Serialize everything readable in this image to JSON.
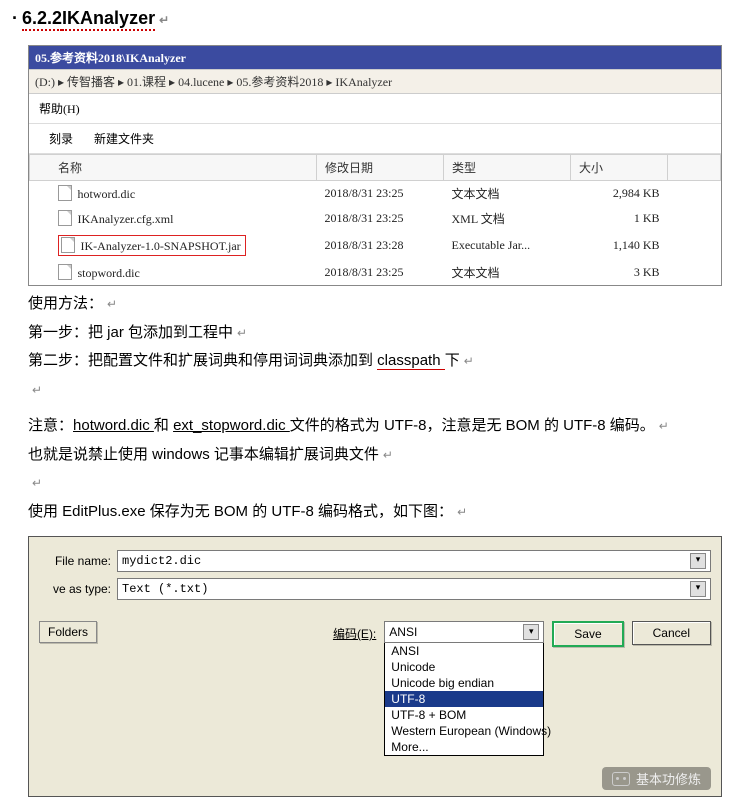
{
  "heading": {
    "bullet": "·",
    "num": "6.2.2",
    "title": "IKAnalyzer"
  },
  "explorer": {
    "title": "05.参考资料2018\\IKAnalyzer",
    "address": "(D:) ▸ 传智播客 ▸ 01.课程 ▸ 04.lucene ▸ 05.参考资料2018 ▸ IKAnalyzer",
    "menu": "帮助(H)",
    "toolbar": {
      "a": "刻录",
      "b": "新建文件夹"
    },
    "cols": {
      "name": "名称",
      "date": "修改日期",
      "type": "类型",
      "size": "大小"
    },
    "rows": [
      {
        "name": "hotword.dic",
        "date": "2018/8/31 23:25",
        "type": "文本文档",
        "size": "2,984 KB",
        "hl": false
      },
      {
        "name": "IKAnalyzer.cfg.xml",
        "date": "2018/8/31 23:25",
        "type": "XML 文档",
        "size": "1 KB",
        "hl": false
      },
      {
        "name": "IK-Analyzer-1.0-SNAPSHOT.jar",
        "date": "2018/8/31 23:28",
        "type": "Executable Jar...",
        "size": "1,140 KB",
        "hl": true
      },
      {
        "name": "stopword.dic",
        "date": "2018/8/31 23:25",
        "type": "文本文档",
        "size": "3 KB",
        "hl": false
      }
    ]
  },
  "text": {
    "p1": "使用方法：",
    "p2": "第一步：把 jar 包添加到工程中",
    "p3a": "第二步：把配置文件和扩展词典和停用词词典添加到 ",
    "p3b": "classpath ",
    "p3c": "下",
    "p4a": "注意：",
    "p4b": "hotword.dic ",
    "p4c": "和 ",
    "p4d": "ext_stopword.dic ",
    "p4e": "文件的格式为 UTF-8，注意是无 BOM 的 UTF-8 编码。",
    "p5": "也就是说禁止使用 windows 记事本编辑扩展词典文件",
    "p6": "使用 EditPlus.exe 保存为无 BOM 的 UTF-8 编码格式，如下图："
  },
  "saveas": {
    "filename_label": "File name:",
    "filename_value": "mydict2.dic",
    "type_label": "ve as type:",
    "type_value": "Text (*.txt)",
    "folders": "Folders",
    "encoding_label": "编码(E):",
    "encoding_value": "ANSI",
    "options": [
      "ANSI",
      "Unicode",
      "Unicode big endian",
      "UTF-8",
      "UTF-8 + BOM",
      "Western European (Windows)",
      "More..."
    ],
    "selected_index": 3,
    "save": "Save",
    "cancel": "Cancel"
  },
  "watermark": "基本功修炼"
}
